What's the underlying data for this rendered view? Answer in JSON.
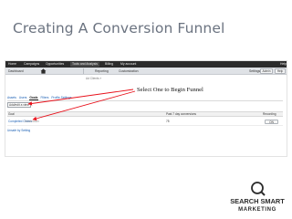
{
  "slide": {
    "title": "Creating A Conversion Funnel"
  },
  "nav_primary": {
    "items": [
      "Home",
      "Campaigns",
      "Opportunities",
      "Tools and Analysis",
      "Billing",
      "My account"
    ],
    "active_index": 3,
    "help": "Help"
  },
  "nav_secondary": {
    "account": "Dashboard",
    "home_icon": "home-icon",
    "items": [
      "Reporting",
      "Customization"
    ],
    "right": [
      "Settings"
    ],
    "buttons": [
      "Admin",
      "Help"
    ]
  },
  "breadcrumb": "Ad Clients »",
  "tabs": {
    "items": [
      "Assets",
      "Users",
      "Goals",
      "Filters",
      "Profile Settings"
    ],
    "active_index": 2
  },
  "goal_select": {
    "value": "Add/edit a view"
  },
  "table": {
    "headers": [
      "Goal",
      "Past 7 day conversions",
      "Recording"
    ],
    "row": {
      "name": "Completed Orders",
      "sub": "Destination",
      "value": "75",
      "toggle": "ON"
    }
  },
  "show_link": "Unsafe by Setting",
  "callout": "Select One to Begin Funnel",
  "logo": {
    "line1": "SEARCH SMART",
    "line2": "MARKETING"
  },
  "colors": {
    "arrow": "#e8101a",
    "link": "#1a5fb4",
    "nav_dark": "#2b2b2b"
  }
}
